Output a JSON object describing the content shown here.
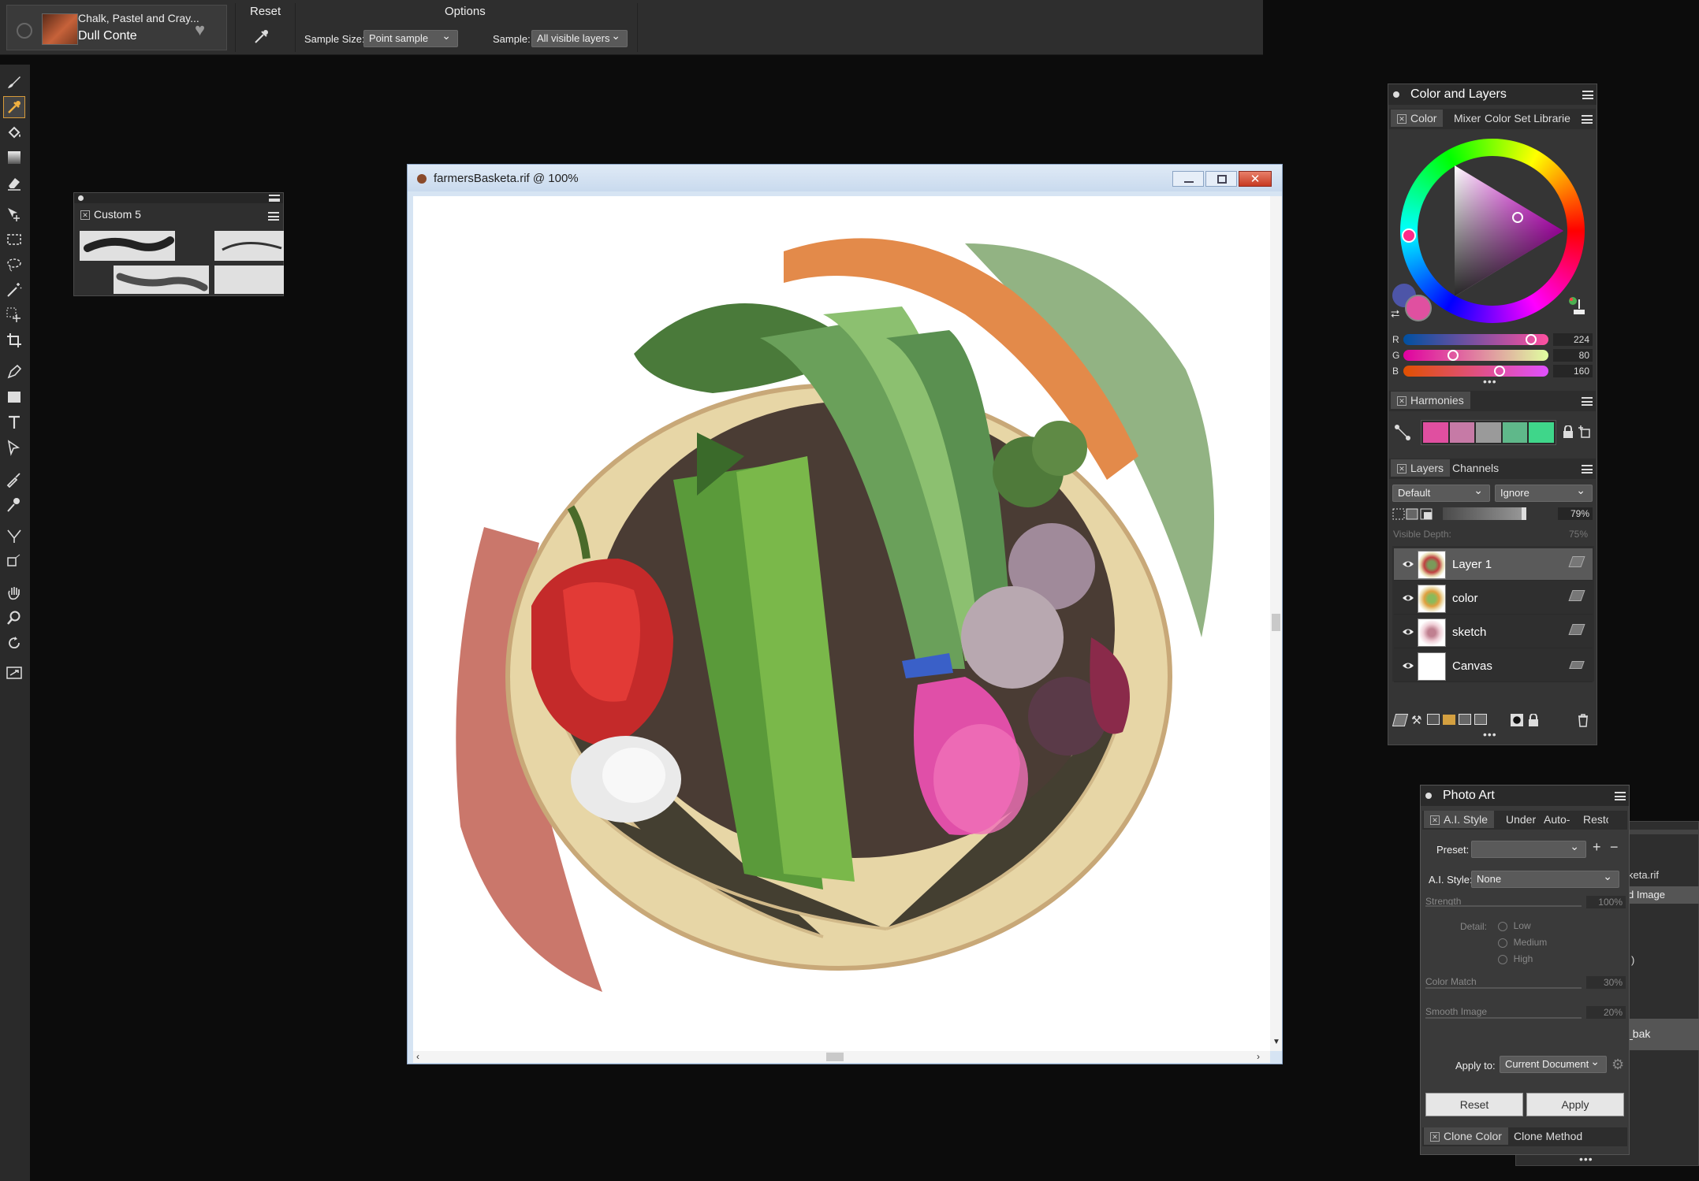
{
  "brush": {
    "category": "Chalk, Pastel and Cray...",
    "variant": "Dull Conte"
  },
  "property_bar": {
    "reset_label": "Reset",
    "options_label": "Options",
    "sample_size_label": "Sample Size:",
    "sample_size_value": "Point sample",
    "sample_label": "Sample:",
    "sample_value": "All visible layers"
  },
  "custom_palette": {
    "title": "Custom 5"
  },
  "document": {
    "title": "farmersBasketa.rif @ 100%"
  },
  "color_layers_panel": {
    "title": "Color and Layers",
    "tabs": [
      "Color",
      "Mixer",
      "Color Set Librarie"
    ],
    "rgb": {
      "r_label": "R",
      "r": "224",
      "g_label": "G",
      "g": "80",
      "b_label": "B",
      "b": "160"
    },
    "current_color": "#e050a0",
    "harmonies_title": "Harmonies",
    "harmony_swatches": [
      "#e04fa0",
      "#c67aa6",
      "#9a9a9a",
      "#5fb88a",
      "#3fd68a"
    ],
    "layers_tab": "Layers",
    "channels_tab": "Channels",
    "composite_method": "Default",
    "preserve": "Ignore",
    "opacity": "79%",
    "visible_depth_label": "Visible Depth:",
    "visible_depth": "75%",
    "layers": [
      {
        "name": "Layer 1"
      },
      {
        "name": "color"
      },
      {
        "name": "sketch"
      },
      {
        "name": "Canvas"
      }
    ]
  },
  "photo_art": {
    "title": "Photo Art",
    "tabs": [
      "A.I. Style",
      "Under",
      "Auto-",
      "Resto"
    ],
    "preset_label": "Preset:",
    "preset_value": "",
    "ai_style_label": "A.I. Style:",
    "ai_style_value": "None",
    "strength_label": "Strength",
    "strength_value": "100%",
    "detail_label": "Detail:",
    "detail_options": [
      "Low",
      "Medium",
      "High"
    ],
    "color_match_label": "Color Match",
    "color_match_value": "30%",
    "smooth_image_label": "Smooth Image",
    "smooth_image_value": "20%",
    "apply_to_label": "Apply to:",
    "apply_to_value": "Current Document",
    "reset_button": "Reset",
    "apply_button": "Apply",
    "bottom_tabs": [
      "Clone Color",
      "Clone Method"
    ]
  },
  "behind_panel": {
    "line1": "keta.rif",
    "line2": "d Image",
    "line3": ")",
    "line4": "_bak"
  }
}
